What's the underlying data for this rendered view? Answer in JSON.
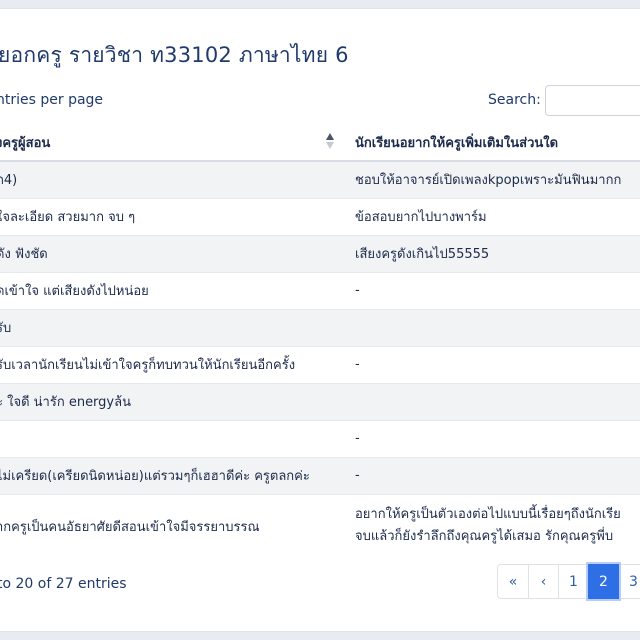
{
  "header": {
    "title": "ยอกครู รายวิชา ท33102 ภาษาไทย 6"
  },
  "controls": {
    "entries_label": "ntries per page",
    "search_label": "Search:",
    "search_value": ""
  },
  "table": {
    "columns": [
      "งครูผู้สอน",
      "นักเรียนอยากให้ครูเพิ่มเติมในส่วนใด"
    ],
    "rows": [
      {
        "a": "ถ4)",
        "b": "ชอบให้อาจารย์เปิดเพลงkpopเพราะมันฟินมากก"
      },
      {
        "a": "ใจละเอียด สวยมาก จบ ๆ",
        "b": "ข้อสอบยากไปบางพาร์ม"
      },
      {
        "a": "ดัง ฟังชัด",
        "b": "เสียงครูดังเกินไป55555"
      },
      {
        "a": "ูดเข้าใจ แต่เสียงดังไปหน่อย",
        "b": "-"
      },
      {
        "a": "รับ",
        "b": ""
      },
      {
        "a": "รับเวลานักเรียนไม่เข้าใจครูก็ทบทวนให้นักเรียนอีกครั้ง",
        "b": "-"
      },
      {
        "a": "ะ ใจดี น่ารัก energyล้น",
        "b": ""
      },
      {
        "a": "",
        "b": "-"
      },
      {
        "a": "ไม่เครียด(เครียดนิดหน่อย)แต่รวมๆก็เฮฮาดีค่ะ ครูตลกค่ะ",
        "b": "-"
      },
      {
        "a": "ากครูเป็นคนอัธยาศัยดีสอนเข้าใจมีจรรยาบรรณ",
        "b": "อยากให้ครูเป็นตัวเองต่อไปแบบนี้เรื่อยๆถึงนักเรีย",
        "b2": "จบแล้วก็ยังรำลึกถึงคุณครูได้เสมอ รักคุณครูพี่บ"
      }
    ]
  },
  "footer": {
    "info": "to 20 of 27 entries",
    "pagination": [
      "«",
      "‹",
      "1",
      "2",
      "3"
    ],
    "active_page": "2"
  },
  "icons": {
    "sort": "sort-asc-icon"
  },
  "colors": {
    "accent": "#2f6fe6",
    "text": "#1f3a6b"
  }
}
